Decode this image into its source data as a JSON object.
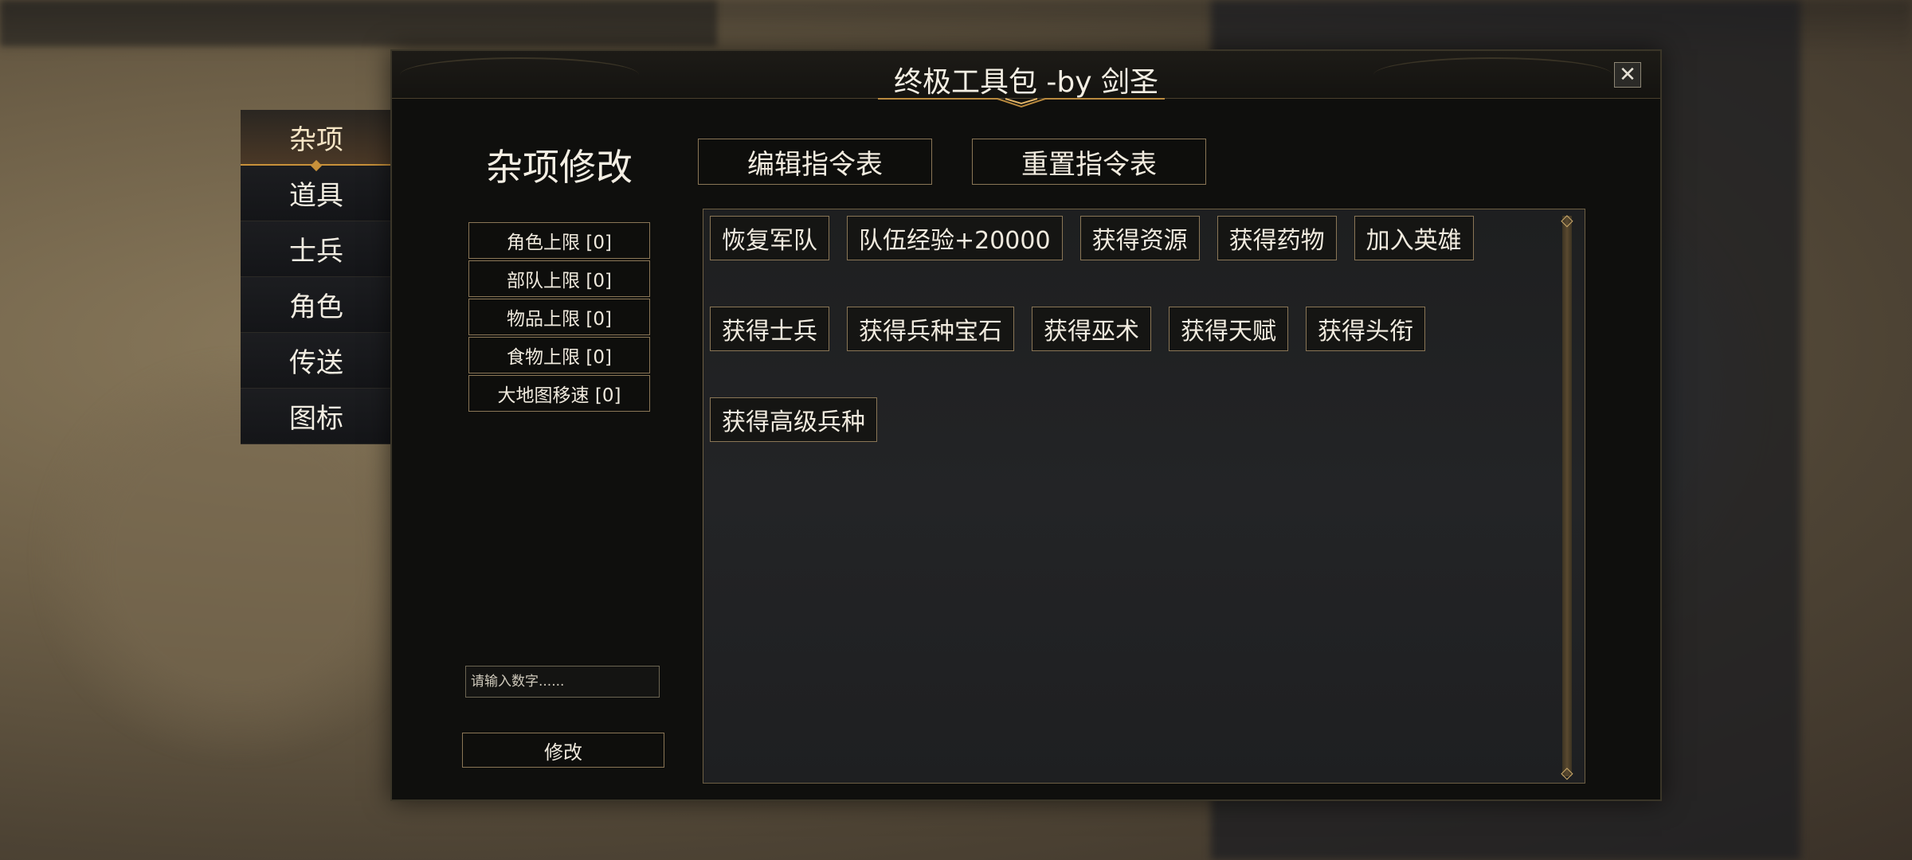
{
  "window": {
    "title": "终极工具包 -by 剑圣",
    "close_glyph": "✕"
  },
  "nav": {
    "items": [
      {
        "label": "杂项",
        "active": true
      },
      {
        "label": "道具",
        "active": false
      },
      {
        "label": "士兵",
        "active": false
      },
      {
        "label": "角色",
        "active": false
      },
      {
        "label": "传送",
        "active": false
      },
      {
        "label": "图标",
        "active": false
      }
    ]
  },
  "section": {
    "title": "杂项修改",
    "edit_button": "编辑指令表",
    "reset_button": "重置指令表"
  },
  "stats": [
    "角色上限 [0]",
    "部队上限 [0]",
    "物品上限 [0]",
    "食物上限 [0]",
    "大地图移速 [0]"
  ],
  "input": {
    "placeholder": "请输入数字......"
  },
  "modify_button": "修改",
  "commands": {
    "row1": [
      "恢复军队",
      "队伍经验+20000",
      "获得资源",
      "获得药物",
      "加入英雄"
    ],
    "row2": [
      "获得士兵",
      "获得兵种宝石",
      "获得巫术",
      "获得天赋",
      "获得头衔"
    ],
    "row3": [
      "获得高级兵种"
    ]
  },
  "colors": {
    "accent_gold": "#c8913a",
    "border_bronze": "#8a7656",
    "window_bg": "#0f0f0d"
  },
  "icons": {
    "close": "close-icon",
    "scroll_up": "diamond-icon",
    "scroll_down": "diamond-icon"
  }
}
